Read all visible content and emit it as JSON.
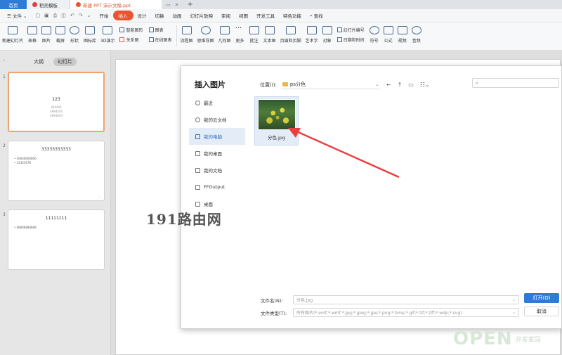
{
  "tabs": {
    "home": "首页",
    "template": "稻壳模板",
    "document": "新建 PPT 演示文稿.ppt"
  },
  "menu": {
    "file": "文件",
    "items": [
      "开始",
      "插入",
      "设计",
      "切换",
      "动画",
      "幻灯片放映",
      "审阅",
      "视图",
      "开发工具",
      "特色功能"
    ],
    "active": "插入",
    "search": "查找"
  },
  "ribbon": {
    "buttons": [
      "新建幻灯片",
      "表格",
      "图片",
      "截屏",
      "形状",
      "图标库",
      "3D演示"
    ],
    "smart_shape": "智能图形",
    "chart": "图表",
    "relation": "关系图",
    "online_chart": "在线图表",
    "buttons2": [
      "流程图",
      "思维导图",
      "几何图",
      "更多",
      "批注",
      "文本框",
      "页眉和页脚",
      "艺术字",
      "对象"
    ],
    "slide_number": "幻灯片编号",
    "datetime": "日期和时间",
    "buttons3": [
      "符号",
      "公式",
      "视频",
      "音频"
    ]
  },
  "left_panel": {
    "tab_outline": "大纲",
    "tab_slides": "幻灯片",
    "slides": [
      {
        "num": "1",
        "title": "123",
        "lines": [
          "444444",
          "4994444",
          "4994444"
        ]
      },
      {
        "num": "2",
        "title": "33333333333",
        "bullets": [
          "46666666666",
          "12345678"
        ]
      },
      {
        "num": "3",
        "title": "11111111",
        "bullets": [
          "88888888888"
        ]
      }
    ]
  },
  "dialog": {
    "title": "插入图片",
    "location_label": "位置(I):",
    "location_value": "ps分色",
    "sidebar": [
      "最近",
      "我的云文档",
      "我的电脑",
      "我的桌面",
      "我的文档",
      "FFOutput",
      "桌面"
    ],
    "selected_sidebar": "我的电脑",
    "file_name": "分色.jpg",
    "filename_label": "文件名(N):",
    "filename_value": "分色.jpg",
    "filetype_label": "文件类型(T):",
    "filetype_value": "所有图片(*.emf;*.wmf;*.jpg;*.jpeg;*.jpe;*.png;*.bmp;*.gif;*.tif;*.tiff;*.wdp;*.svg)",
    "open_button": "打开(O)",
    "cancel_button": "取消"
  },
  "watermarks": {
    "text1": "191路由网",
    "text2": "OPEN",
    "text3": "开发家园"
  },
  "colors": {
    "accent_blue": "#2f7bd6",
    "accent_orange": "#e8562f",
    "arrow_red": "#e84040"
  }
}
